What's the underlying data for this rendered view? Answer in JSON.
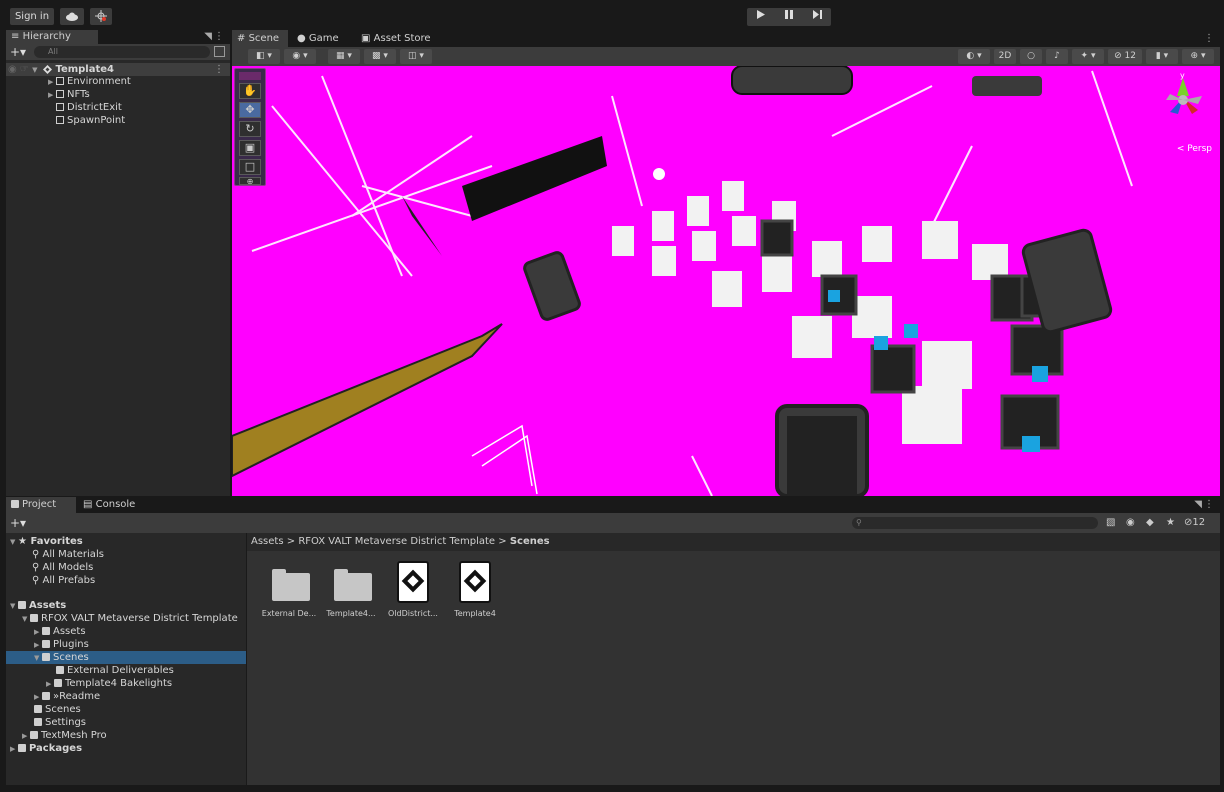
{
  "toolbar": {
    "signin_label": "Sign in",
    "cloud_icon": "cloud-icon",
    "collab_icon": "collab-icon",
    "play_icon": "play-icon",
    "pause_icon": "pause-icon",
    "step_icon": "step-icon"
  },
  "hierarchy": {
    "tab_label": "Hierarchy",
    "search_placeholder": "All",
    "root": "Template4",
    "items": [
      "Environment",
      "NFTs",
      "DistrictExit",
      "SpawnPoint"
    ]
  },
  "scene": {
    "tabs": [
      "Scene",
      "Game",
      "Asset Store"
    ],
    "mode_2d": "2D",
    "persp_label": "< Persp",
    "gizmo_y": "y",
    "hidden_count": "12",
    "background_color": "#ff00ff"
  },
  "project": {
    "tabs": [
      "Project",
      "Console"
    ],
    "favorites": {
      "label": "Favorites",
      "items": [
        "All Materials",
        "All Models",
        "All Prefabs"
      ]
    },
    "assets_label": "Assets",
    "tree": {
      "template": "RFOX VALT Metaverse District Template",
      "assets": "Assets",
      "plugins": "Plugins",
      "scenes": "Scenes",
      "external": "External Deliverables",
      "bakelights": "Template4 Bakelights",
      "readme": "»Readme",
      "scenes2": "Scenes",
      "settings": "Settings",
      "textmesh": "TextMesh Pro",
      "packages": "Packages"
    },
    "breadcrumb": {
      "a": "Assets",
      "b": "RFOX VALT Metaverse District Template",
      "c": "Scenes",
      "sep": ">"
    },
    "grid": [
      "External De...",
      "Template4...",
      "OldDistrict...",
      "Template4"
    ]
  }
}
